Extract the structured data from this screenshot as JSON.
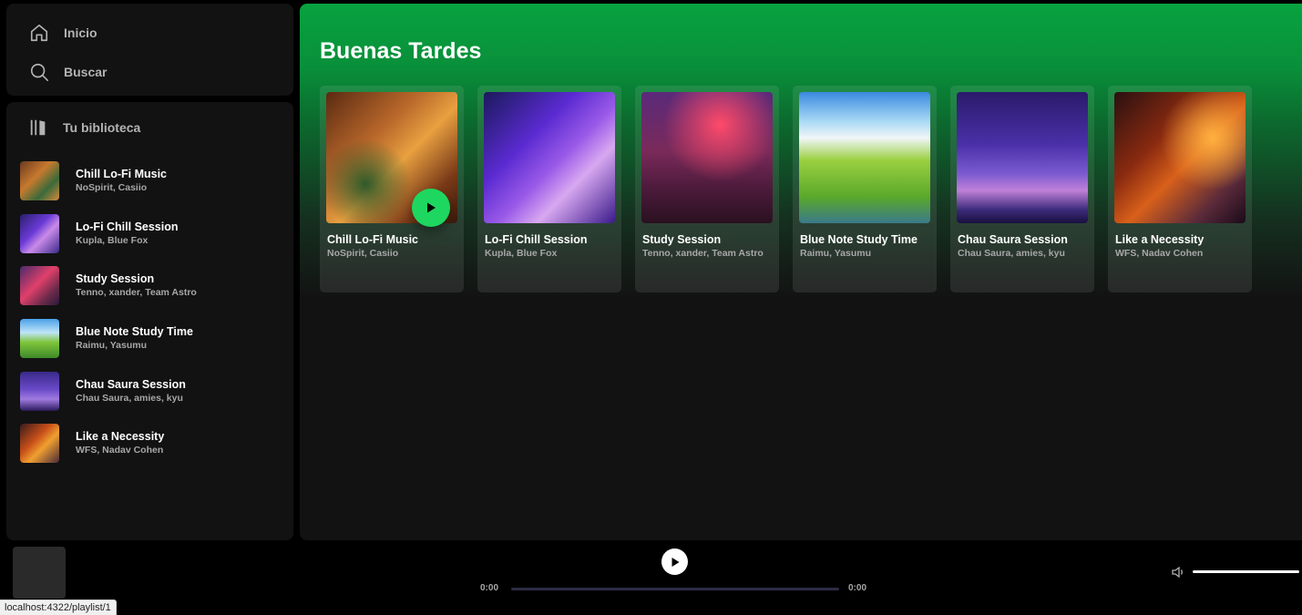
{
  "nav": {
    "home_label": "Inicio",
    "search_label": "Buscar"
  },
  "library": {
    "title": "Tu biblioteca",
    "items": [
      {
        "title": "Chill Lo-Fi Music",
        "subtitle": "NoSpirit, Casiio"
      },
      {
        "title": "Lo-Fi Chill Session",
        "subtitle": "Kupla, Blue Fox"
      },
      {
        "title": "Study Session",
        "subtitle": "Tenno, xander, Team Astro"
      },
      {
        "title": "Blue Note Study Time",
        "subtitle": "Raimu, Yasumu"
      },
      {
        "title": "Chau Saura Session",
        "subtitle": "Chau Saura, amies, kyu"
      },
      {
        "title": "Like a Necessity",
        "subtitle": "WFS, Nadav Cohen"
      }
    ]
  },
  "main": {
    "greeting": "Buenas Tardes",
    "cards": [
      {
        "title": "Chill Lo-Fi Music",
        "subtitle": "NoSpirit, Casiio"
      },
      {
        "title": "Lo-Fi Chill Session",
        "subtitle": "Kupla, Blue Fox"
      },
      {
        "title": "Study Session",
        "subtitle": "Tenno, xander, Team Astro"
      },
      {
        "title": "Blue Note Study Time",
        "subtitle": "Raimu, Yasumu"
      },
      {
        "title": "Chau Saura Session",
        "subtitle": "Chau Saura, amies, kyu"
      },
      {
        "title": "Like a Necessity",
        "subtitle": "WFS, Nadav Cohen"
      }
    ]
  },
  "player": {
    "current_time": "0:00",
    "total_time": "0:00",
    "progress": 0,
    "volume": 1.0
  },
  "status_bar": {
    "url": "localhost:4322/playlist/1"
  },
  "colors": {
    "accent": "#1ed760",
    "panel": "#121212",
    "header_green": "#08a340"
  }
}
